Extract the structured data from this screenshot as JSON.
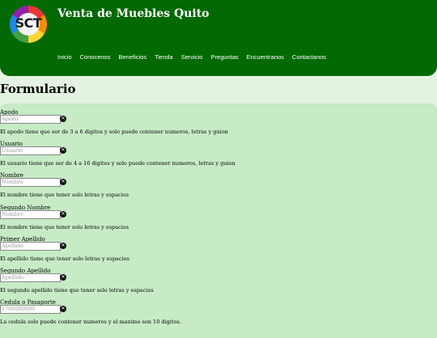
{
  "brand": {
    "logo_text": "SCT",
    "title": "Venta de Muebles Quito"
  },
  "nav": [
    "Inicio",
    "Conocenos",
    "Beneficios",
    "Tienda",
    "Servicio",
    "Preguntas",
    "Encuentranos",
    "Contactanos"
  ],
  "form": {
    "title": "Formulario",
    "fields": [
      {
        "label": "Apodo",
        "placeholder": "Apodo",
        "hint": "El apodo tiene que ser de 3 a 6 digitos y solo puede contener numeros, letras y guion"
      },
      {
        "label": "Usuario",
        "placeholder": "Usuario",
        "hint": "El usuario tiene que ser de 4 a 16 digitos y solo puede contener numeros, letras y guion"
      },
      {
        "label": "Nombre",
        "placeholder": "Nombre",
        "hint": "El nombre tiene que tener solo letras y espacios"
      },
      {
        "label": "Segundo Nombre",
        "placeholder": "Nombre",
        "hint": "El nombre tiene que tener solo letras y espacios"
      },
      {
        "label": "Primer Apellido",
        "placeholder": "Apellido",
        "hint": "El apellido tiene que tener solo letras y espacios"
      },
      {
        "label": "Segundo Apellido",
        "placeholder": "Apellido",
        "hint": "El segundo apellido tiene que tener solo letras y espacios"
      },
      {
        "label": "Cedula o Pasaporte",
        "placeholder": "1700000000",
        "hint": "La cedula solo puede contener numeros y el maximo son 10 digitos."
      }
    ]
  },
  "colors": {
    "header": "#036903",
    "panel": "#c6ebc5",
    "page": "#e4f3e1"
  },
  "icons": {
    "field_status": "clear-circle-icon"
  }
}
